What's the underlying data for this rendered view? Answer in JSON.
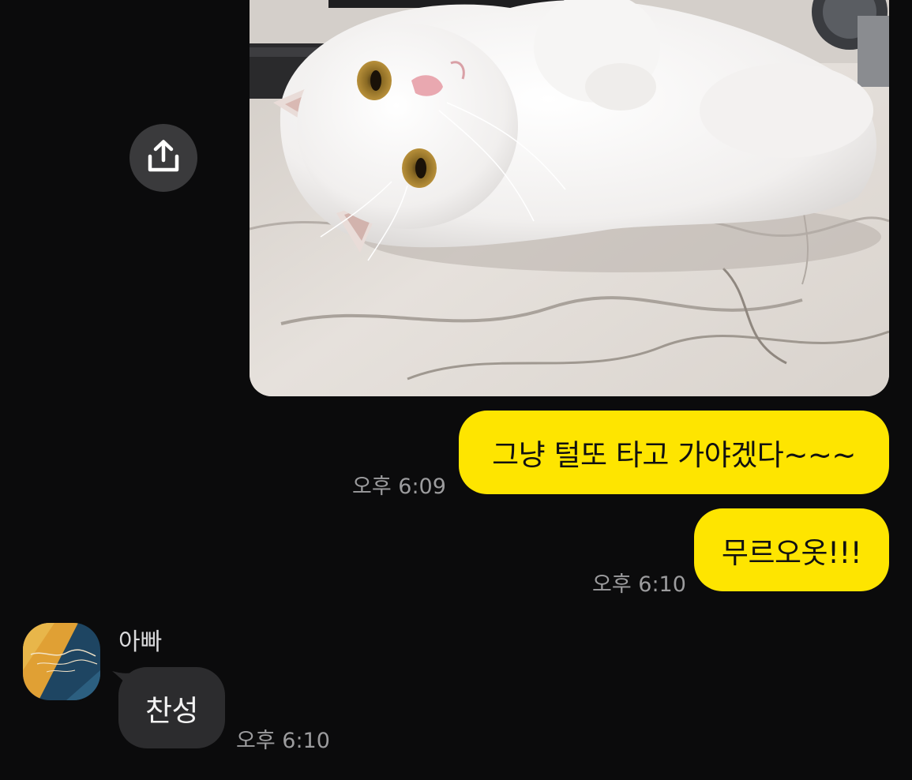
{
  "share_button": {
    "icon": "share-upload-icon"
  },
  "photo_message": {
    "subject": "white-cat-on-marble"
  },
  "messages": [
    {
      "side": "me",
      "text": "그냥 털또 타고 가야겠다~~~",
      "time": "오후 6:09"
    },
    {
      "side": "me",
      "text": "무르오옷!!!",
      "time": "오후 6:10"
    },
    {
      "side": "other",
      "sender": "아빠",
      "text": "찬성",
      "time": "오후 6:10"
    }
  ],
  "colors": {
    "background": "#0b0b0c",
    "my_bubble": "#fee500",
    "other_bubble": "#2c2c2e",
    "timestamp": "#9c9c9e"
  }
}
